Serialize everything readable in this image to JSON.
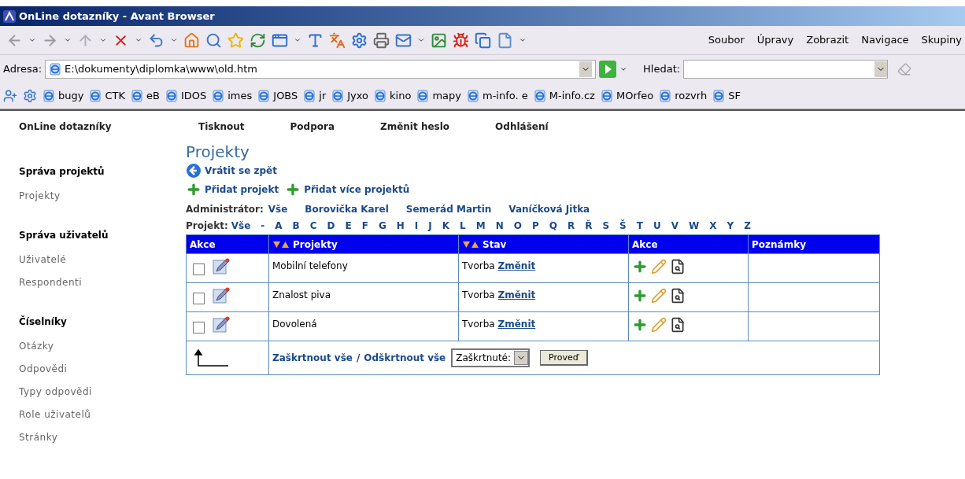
{
  "window": {
    "title": "OnLine dotazníky - Avant Browser"
  },
  "menu": [
    "Soubor",
    "Úpravy",
    "Zobrazit",
    "Navigace",
    "Skupiny"
  ],
  "address_bar": {
    "label": "Adresa:",
    "value": "E:\\dokumenty\\diplomka\\www\\old.htm"
  },
  "search": {
    "label": "Hledat:"
  },
  "links": [
    "bugy",
    "CTK",
    "eB",
    "IDOS",
    "imes",
    "JOBS",
    "jr",
    "Jyxo",
    "kino",
    "mapy",
    "m-info. e",
    "M-info.cz",
    "MOrfeo",
    "rozvrh",
    "SF"
  ],
  "top_nav": [
    "OnLine dotazníky",
    "Tisknout",
    "Podpora",
    "Změnit heslo",
    "Odhlášení"
  ],
  "sidebar": [
    {
      "title": "Správa projektů",
      "items": [
        "Projekty"
      ]
    },
    {
      "title": "Správa uživatelů",
      "items": [
        "Uživatelé",
        "Respondenti"
      ]
    },
    {
      "title": "Číselníky",
      "items": [
        "Otázky",
        "Odpovědi",
        "Typy odpovědi",
        "Role uživatelů",
        "Stránky"
      ]
    }
  ],
  "page_title": "Projekty",
  "back_link": "Vrátit se zpět",
  "add_links": [
    "Přidat projekt",
    "Přidat více projektů"
  ],
  "admin_filter": {
    "label": "Administrátor:",
    "items": [
      "Vše",
      "Borovička Karel",
      "Semerád Martin",
      "Vaníčková Jitka"
    ]
  },
  "project_filter": {
    "label": "Projekt:",
    "items": [
      "Vše",
      "-",
      "A",
      "B",
      "C",
      "D",
      "E",
      "F",
      "G",
      "H",
      "I",
      "J",
      "K",
      "L",
      "M",
      "N",
      "O",
      "P",
      "Q",
      "R",
      "Ř",
      "S",
      "Š",
      "T",
      "U",
      "V",
      "W",
      "X",
      "Y",
      "Z"
    ]
  },
  "table": {
    "columns": [
      {
        "label": "Akce",
        "sortable": false
      },
      {
        "label": "Projekty",
        "sortable": true
      },
      {
        "label": "Stav",
        "sortable": true
      },
      {
        "label": "Akce",
        "sortable": false
      },
      {
        "label": "Poznámky",
        "sortable": false
      }
    ],
    "rows": [
      {
        "checked": false,
        "name": "Mobilní telefony",
        "state": "Tvorba",
        "change": "Změnit"
      },
      {
        "checked": false,
        "name": "Znalost piva",
        "state": "Tvorba",
        "change": "Změnit"
      },
      {
        "checked": false,
        "name": "Dovolená",
        "state": "Tvorba",
        "change": "Změnit"
      }
    ],
    "footer": {
      "check_all": "Zaškrtnout vše",
      "separator": "/",
      "uncheck_all": "Odškrtnout vše",
      "select": "Zaškrtnuté:",
      "button": "Proveď"
    }
  }
}
